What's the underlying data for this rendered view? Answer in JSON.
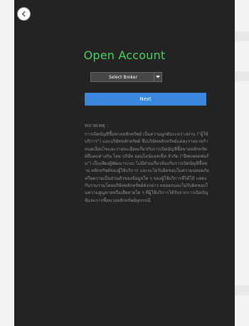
{
  "header": {
    "back_icon": "back-chevron-icon"
  },
  "title": "Open Account",
  "broker_select": {
    "selected": "Select Broker",
    "icon": "chevron-down-icon"
  },
  "next_button": {
    "label": "Next"
  },
  "note": {
    "title": "หมายเหตุ :",
    "body": "การเปิดบัญชีซื้อขายหลักทรัพย์ เป็นความผูกพันระหว่างท่าน (\"ผู้ใช้บริการ\") และบริษัทหลักทรัพย์ ซึ่งบริษัทหลักทรัพย์แต่ละรายอาจกำหนดเงื่อนไขและรายละเอียดเกี่ยวกับการเปิดบัญชีซื้อขายหลักทรัพย์ที่แตกต่างกัน โดย บริษัท ออนไลน์แอสเซ็ท จำกัด (\"อีฟแพลตฟอร์ม\") เป็นเพียงผู้พัฒนาระบบ ไม่มีส่วนเกี่ยวข้องกับการเปิดบัญชีซื้อขาย หลักทรัพย์ของผู้ใช้บริการ และจะไม่รับผิดชอบในความปลอดภัยหรือความเป็นส่วนตัวของข้อมูลใด ๆ ของผู้ใช้บริการที่ได้ให้ แสดงกับรวบรวมโดยบริษัทหลักทรัพย์ดังกล่าว ตลอดจนจะไม่รับผิดชอบในความสูญหายหรือเสียหายใด ๆ ที่ผู้ใช้บริการได้รับจากการเปิดบัญชีและการซื้อขายหลักทรัพย์ทุกกรณี"
  },
  "colors": {
    "panel_bg": "#232323",
    "title": "#4cd060",
    "next_button": "#3b87dd",
    "note_text": "#8c8c8c"
  }
}
